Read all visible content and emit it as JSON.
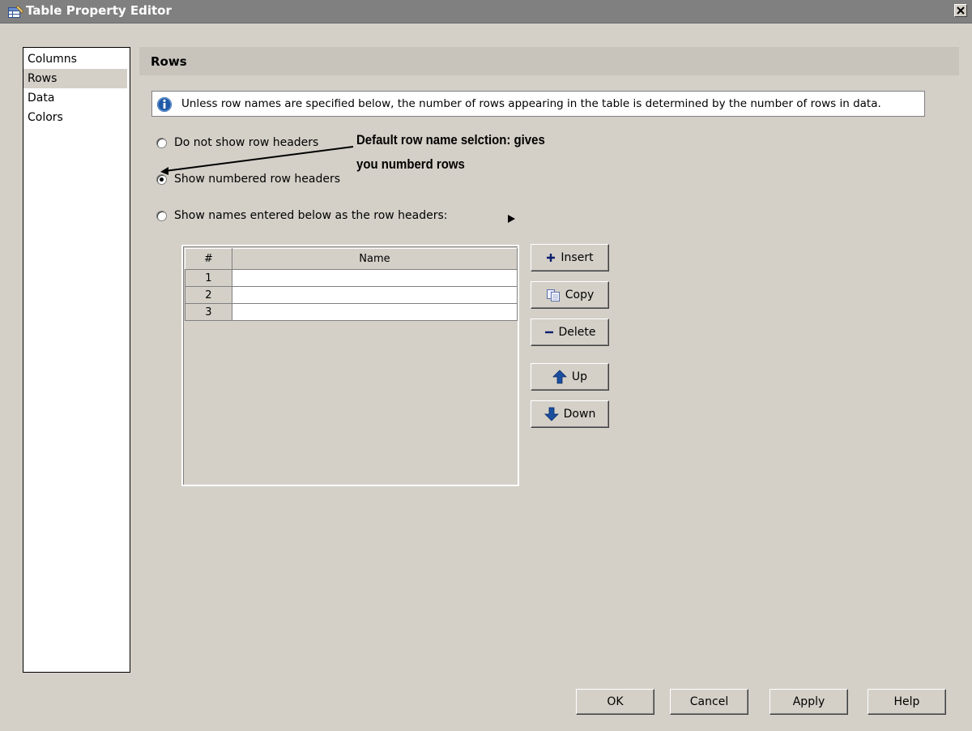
{
  "window": {
    "title": "Table Property Editor",
    "close_label": "×"
  },
  "nav": {
    "items": [
      {
        "label": "Columns",
        "selected": false
      },
      {
        "label": "Rows",
        "selected": true
      },
      {
        "label": "Data",
        "selected": false
      },
      {
        "label": "Colors",
        "selected": false
      }
    ]
  },
  "section": {
    "title": "Rows",
    "info_text": "Unless row names are specified below, the number of rows appearing in the table is determined by the number of rows in data."
  },
  "radios": {
    "none_label": "Do not show row headers",
    "numbered_label": "Show numbered row headers",
    "names_label": "Show names entered below as the row headers:",
    "selected": "numbered"
  },
  "annotation": {
    "line1": "Default row name selction: gives",
    "line2": "you numberd rows"
  },
  "grid": {
    "headers": [
      "#",
      "Name"
    ],
    "rows": [
      {
        "num": "1",
        "name": ""
      },
      {
        "num": "2",
        "name": ""
      },
      {
        "num": "3",
        "name": ""
      }
    ]
  },
  "side_buttons": {
    "insert": "Insert",
    "copy": "Copy",
    "delete": "Delete",
    "up": "Up",
    "down": "Down"
  },
  "footer": {
    "ok": "OK",
    "cancel": "Cancel",
    "apply": "Apply",
    "help": "Help"
  },
  "colors": {
    "titlebar": "#808080",
    "dialog_bg": "#d4d0c8",
    "info_icon": "#1f5aa6",
    "arrow_icon": "#1a4fa0"
  }
}
